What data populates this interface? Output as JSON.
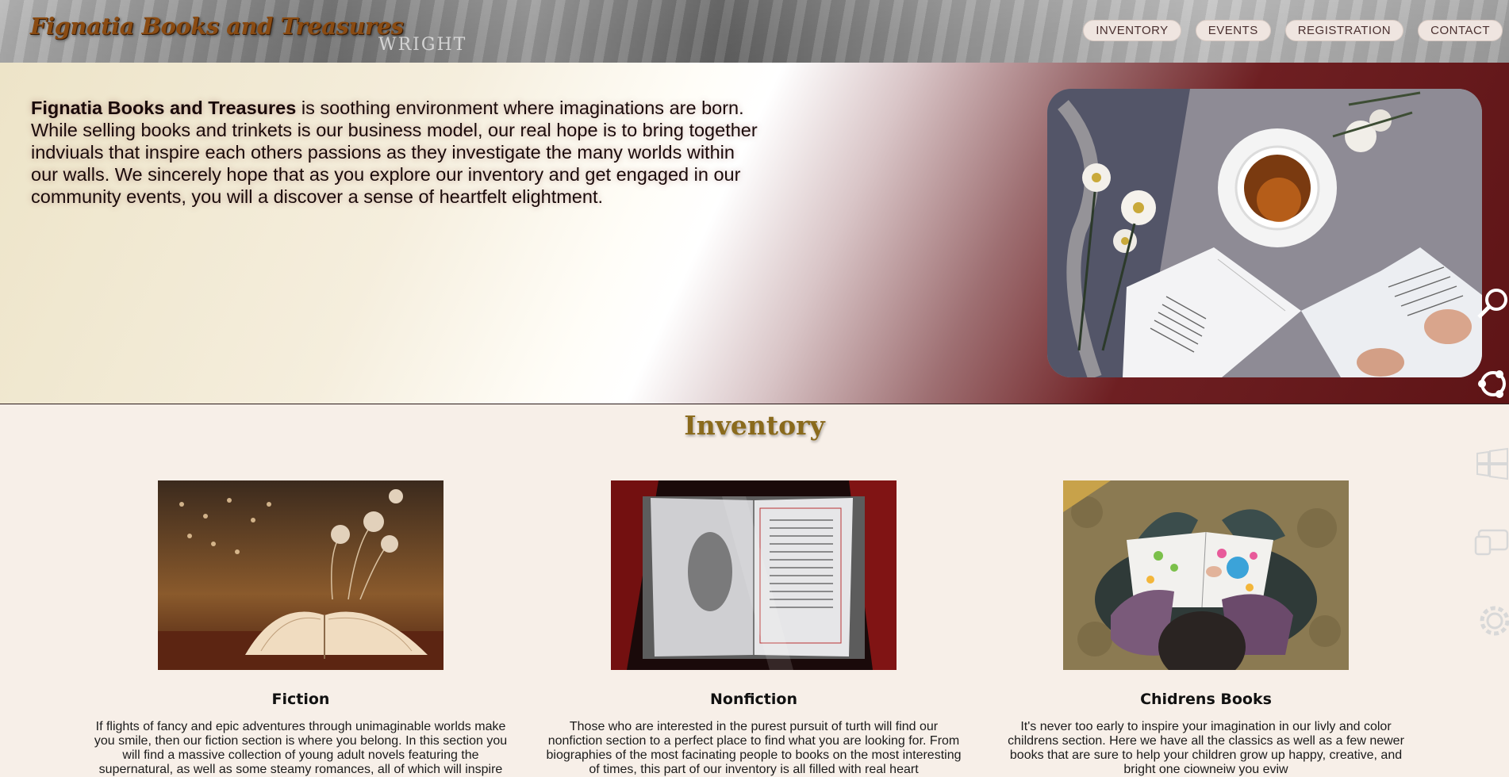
{
  "header": {
    "logo": "Fignatia Books and Treasures",
    "spine_text": "WRIGHT",
    "nav": [
      "INVENTORY",
      "EVENTS",
      "REGISTRATION",
      "CONTACT"
    ]
  },
  "hero": {
    "brand": "Fignatia Books and Treasures",
    "text": " is soothing environment where imaginations are born. While selling books and trinkets is our business model, our real hope is to bring together indviuals that inspire each others passions as they investigate the many worlds within our walls. We sincerely hope that as you explore our inventory and get engaged in our community events, you will a discover a sense of heartfelt elightment."
  },
  "side_icons": [
    "search-icon",
    "share-icon",
    "windows-icon",
    "devices-icon",
    "gear-icon"
  ],
  "inventory": {
    "title": "Inventory",
    "cards": [
      {
        "title": "Fiction",
        "text": "If flights of fancy and epic adventures through unimaginable worlds make you smile, then our fiction section is where you belong. In this section you will find a massive collection of young adult novels featuring the supernatural, as well as some steamy romances, all of which will inspire"
      },
      {
        "title": "Nonfiction",
        "text": "Those who are interested in the purest pursuit of turth will find our nonfiction section to a perfect place to find what you are looking for. From biographies of the most facinating people to books on the most interesting of times, this part of our inventory is all filled with real heart"
      },
      {
        "title": "Chidrens Books",
        "text": "It's never too early to inspire your imagination in our livly and color childrens section. Here we have all the classics as well as a few newer books that are sure to help your children grow up happy, creative, and bright one ciowneiw you eviw"
      }
    ]
  },
  "colors": {
    "accent_gold": "#8a6a1c",
    "logo_brown": "#8a4b12",
    "maroon": "#5e1416",
    "page_bg": "#f7efe8"
  }
}
